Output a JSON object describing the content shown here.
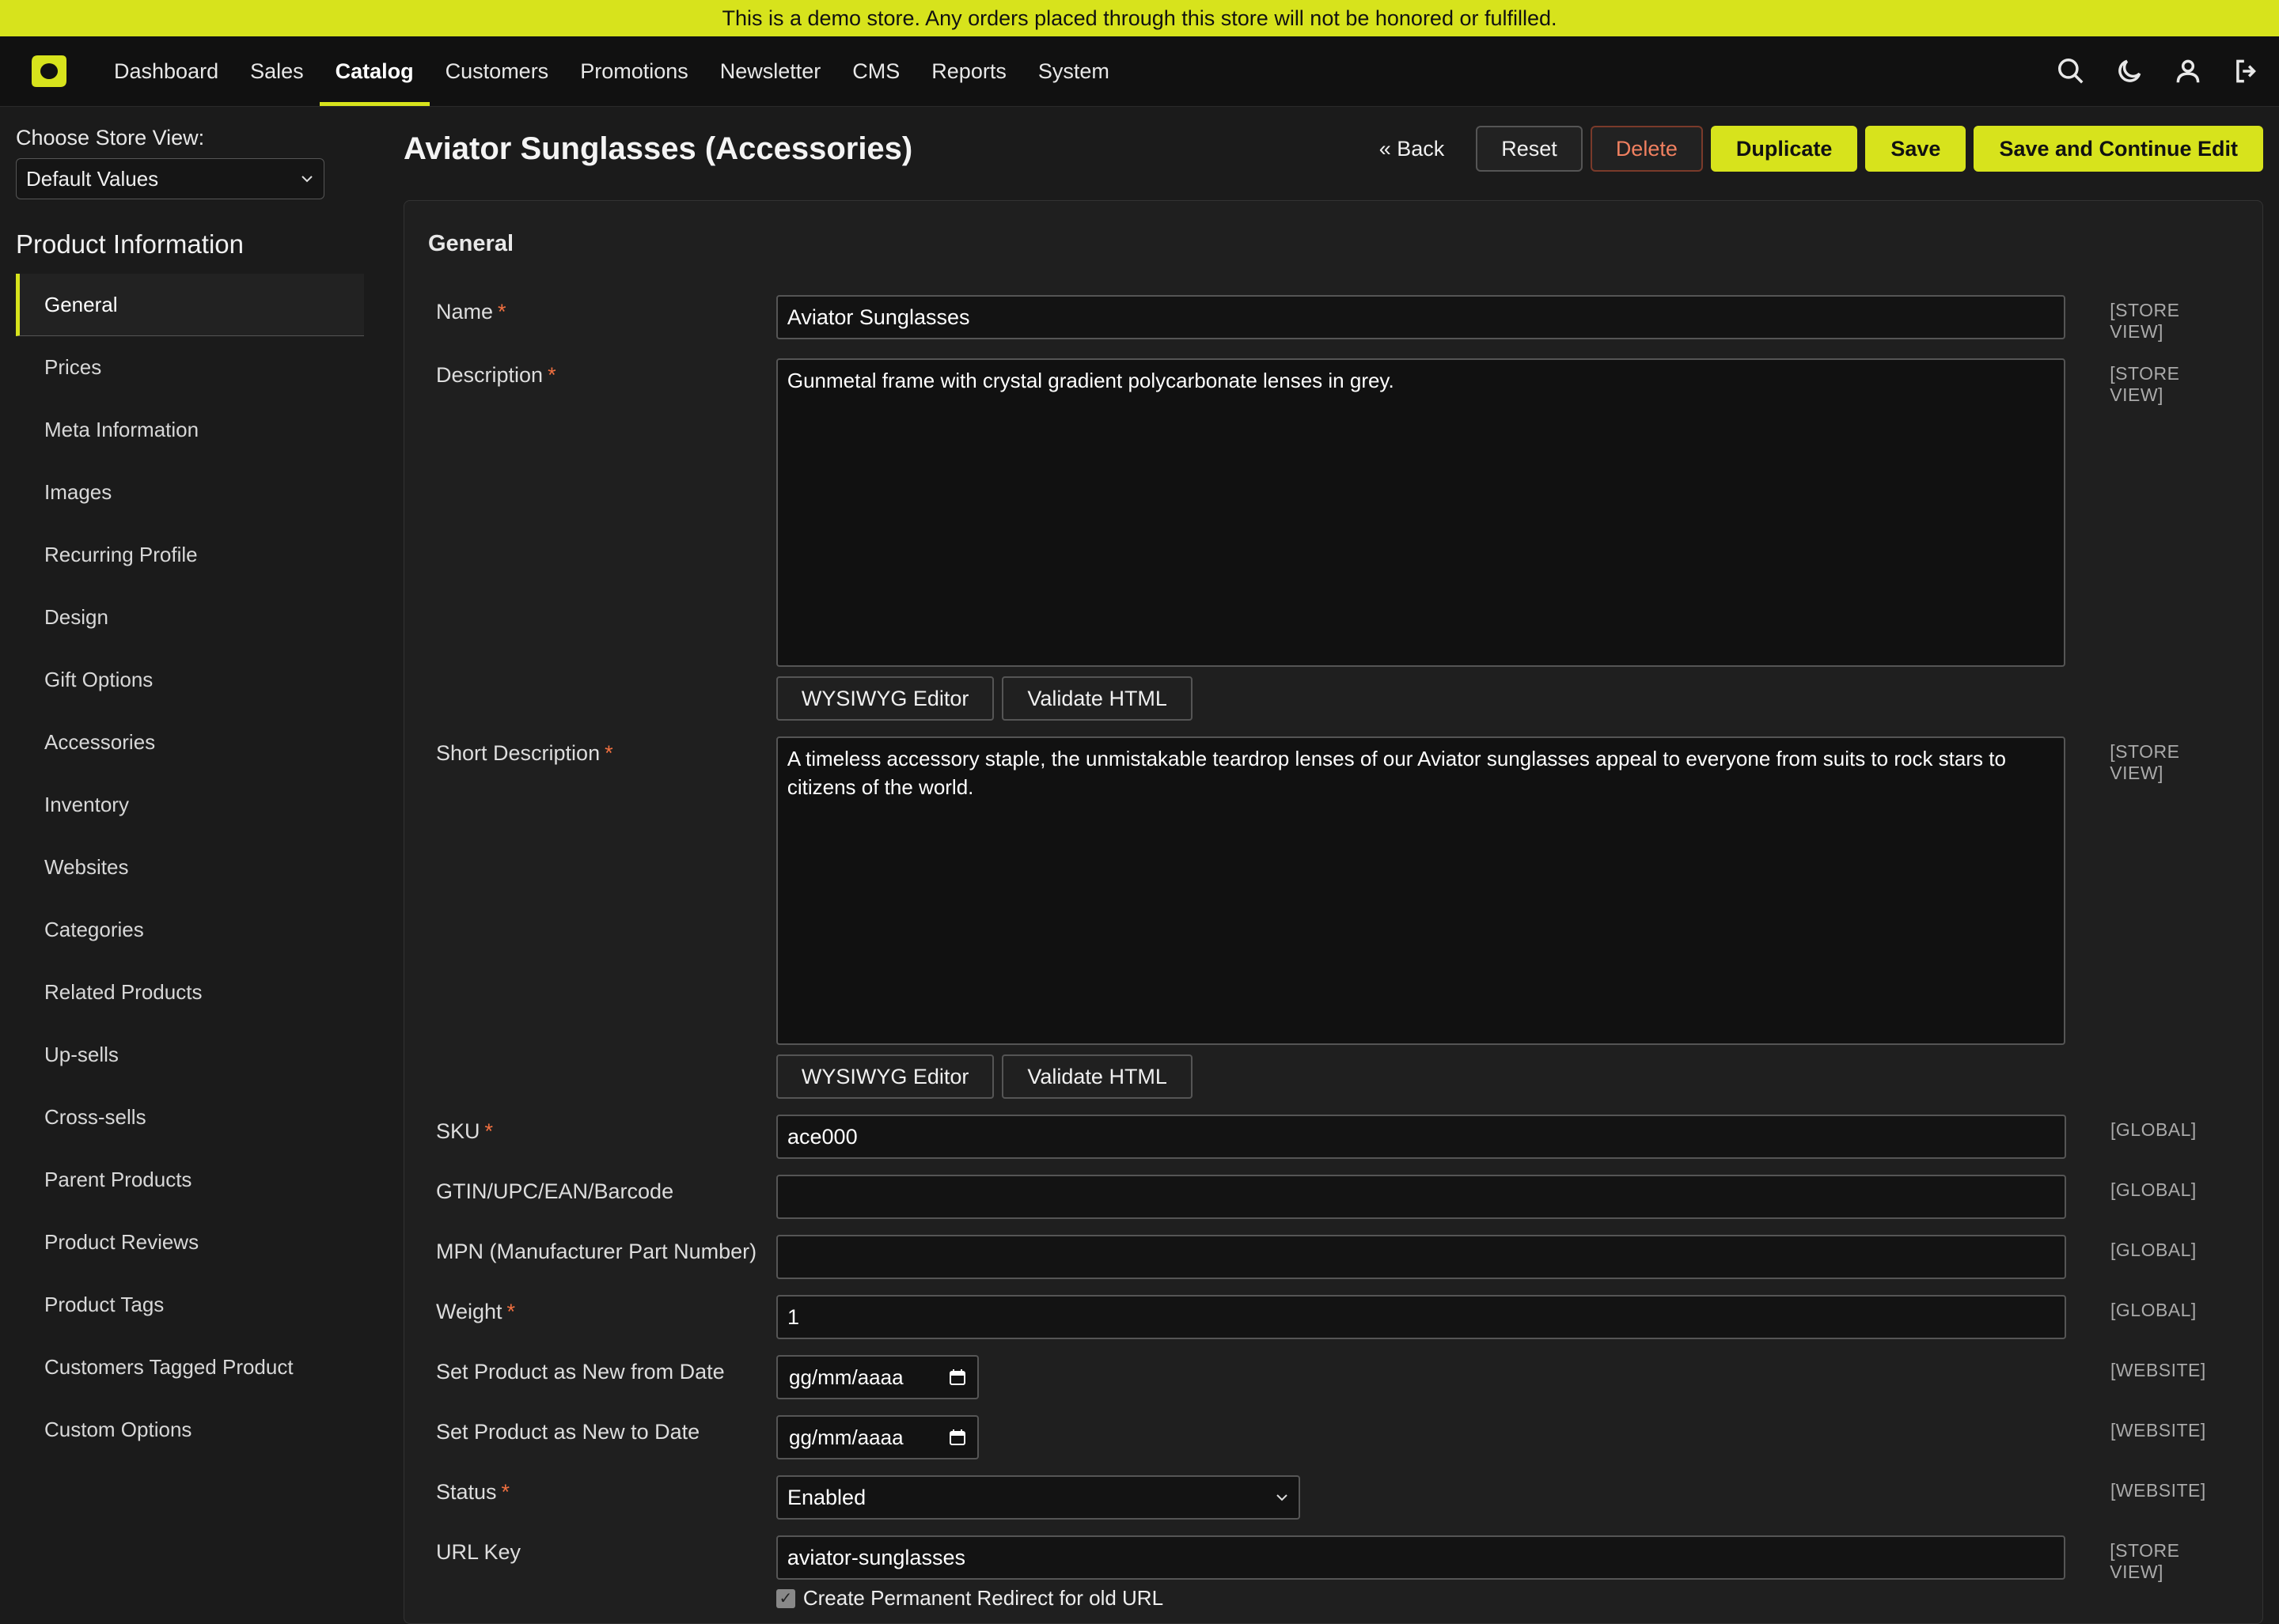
{
  "banner": {
    "text": "This is a demo store. Any orders placed through this store will not be honored or fulfilled."
  },
  "nav": {
    "items": [
      "Dashboard",
      "Sales",
      "Catalog",
      "Customers",
      "Promotions",
      "Newsletter",
      "CMS",
      "Reports",
      "System"
    ],
    "active": "Catalog",
    "icons": [
      "search-icon",
      "moon-icon",
      "user-icon",
      "logout-icon"
    ]
  },
  "sidebar": {
    "store_label": "Choose Store View:",
    "store_value": "Default Values",
    "section_title": "Product Information",
    "items": [
      "General",
      "Prices",
      "Meta Information",
      "Images",
      "Recurring Profile",
      "Design",
      "Gift Options",
      "Accessories",
      "Inventory",
      "Websites",
      "Categories",
      "Related Products",
      "Up-sells",
      "Cross-sells",
      "Parent Products",
      "Product Reviews",
      "Product Tags",
      "Customers Tagged Product",
      "Custom Options"
    ]
  },
  "header": {
    "title": "Aviator Sunglasses (Accessories)",
    "back": "« Back",
    "reset": "Reset",
    "delete": "Delete",
    "duplicate": "Duplicate",
    "save": "Save",
    "save_continue": "Save and Continue Edit"
  },
  "form": {
    "section": "General",
    "name": {
      "label": "Name",
      "value": "Aviator Sunglasses",
      "scope": "[STORE VIEW]"
    },
    "description": {
      "label": "Description",
      "value": "Gunmetal frame with crystal gradient polycarbonate lenses in grey.",
      "scope": "[STORE VIEW]"
    },
    "short_description": {
      "label": "Short Description",
      "value": "A timeless accessory staple, the unmistakable teardrop lenses of our Aviator sunglasses appeal to everyone from suits to rock stars to citizens of the world.",
      "scope": "[STORE VIEW]"
    },
    "editor_btn": "WYSIWYG Editor",
    "validate_btn": "Validate HTML",
    "sku": {
      "label": "SKU",
      "value": "ace000",
      "scope": "[GLOBAL]"
    },
    "gtin": {
      "label": "GTIN/UPC/EAN/Barcode",
      "value": "",
      "scope": "[GLOBAL]"
    },
    "mpn": {
      "label": "MPN (Manufacturer Part Number)",
      "value": "",
      "scope": "[GLOBAL]"
    },
    "weight": {
      "label": "Weight",
      "value": "1",
      "scope": "[GLOBAL]"
    },
    "new_from": {
      "label": "Set Product as New from Date",
      "value": "gg/mm/aaaa",
      "scope": "[WEBSITE]"
    },
    "new_to": {
      "label": "Set Product as New to Date",
      "value": "gg/mm/aaaa",
      "scope": "[WEBSITE]"
    },
    "status": {
      "label": "Status",
      "value": "Enabled",
      "scope": "[WEBSITE]"
    },
    "url_key": {
      "label": "URL Key",
      "value": "aviator-sunglasses",
      "scope": "[STORE VIEW]"
    },
    "redirect_label": "Create Permanent Redirect for old URL",
    "required_mark": "*"
  },
  "colors": {
    "accent": "#d7e31c",
    "danger": "#f08060",
    "bg": "#1b1b1b"
  }
}
